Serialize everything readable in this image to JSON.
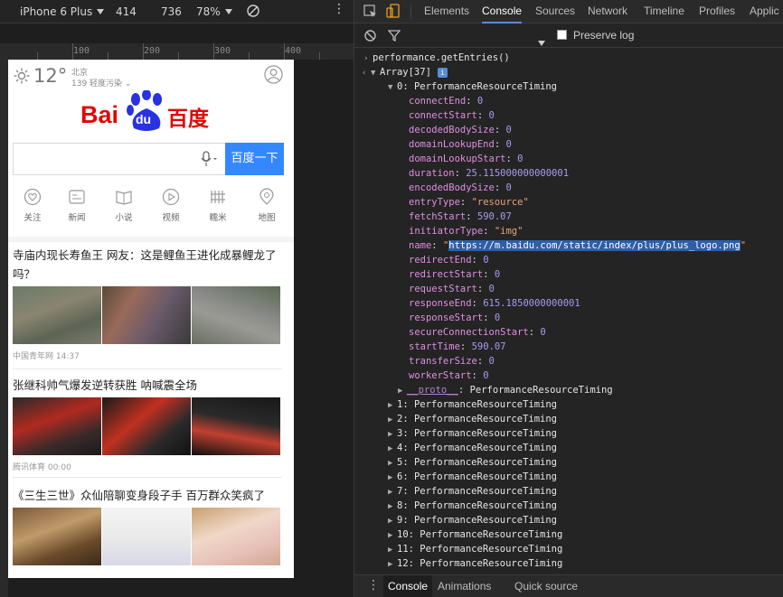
{
  "device_toolbar": {
    "device": "iPhone 6 Plus",
    "width": "414",
    "height": "736",
    "zoom": "78%"
  },
  "ruler": {
    "labels": [
      "100",
      "200",
      "300",
      "400"
    ]
  },
  "phone": {
    "temperature": "12°",
    "city": "北京",
    "air_quality": "139 轻度污染",
    "logo_text_left": "Bai",
    "logo_text_du": "du",
    "logo_text_right": "百度",
    "search_button": "百度一下",
    "nav": [
      "关注",
      "新闻",
      "小说",
      "视频",
      "糯米",
      "地图"
    ],
    "news": [
      {
        "title": "寺庙内现长寿鱼王 网友：这是鲤鱼王进化成暴鲤龙了吗？",
        "source": "中国青年网  14:37"
      },
      {
        "title": "张继科帅气爆发逆转获胜 呐喊震全场",
        "source": "腾讯体育  00:00"
      },
      {
        "title": "《三生三世》众仙陪聊变身段子手 百万群众笑疯了",
        "source": ""
      }
    ]
  },
  "devtools": {
    "tabs": [
      "Elements",
      "Console",
      "Sources",
      "Network",
      "Timeline",
      "Profiles",
      "Applic"
    ],
    "active_tab": "Console",
    "preserve_log": "Preserve log",
    "command": "performance.getEntries()",
    "array_label": "Array[37]",
    "entry0_header": "0: PerformanceResourceTiming",
    "props": [
      {
        "key": "connectEnd",
        "val": "0",
        "type": "n"
      },
      {
        "key": "connectStart",
        "val": "0",
        "type": "n"
      },
      {
        "key": "decodedBodySize",
        "val": "0",
        "type": "n"
      },
      {
        "key": "domainLookupEnd",
        "val": "0",
        "type": "n"
      },
      {
        "key": "domainLookupStart",
        "val": "0",
        "type": "n"
      },
      {
        "key": "duration",
        "val": "25.115000000000001",
        "type": "n"
      },
      {
        "key": "encodedBodySize",
        "val": "0",
        "type": "n"
      },
      {
        "key": "entryType",
        "val": "\"resource\"",
        "type": "s"
      },
      {
        "key": "fetchStart",
        "val": "590.07",
        "type": "n"
      },
      {
        "key": "initiatorType",
        "val": "\"img\"",
        "type": "s"
      },
      {
        "key": "name",
        "val": "https://m.baidu.com/static/index/plus/plus_logo.png",
        "type": "url"
      },
      {
        "key": "redirectEnd",
        "val": "0",
        "type": "n"
      },
      {
        "key": "redirectStart",
        "val": "0",
        "type": "n"
      },
      {
        "key": "requestStart",
        "val": "0",
        "type": "n"
      },
      {
        "key": "responseEnd",
        "val": "615.1850000000001",
        "type": "n"
      },
      {
        "key": "responseStart",
        "val": "0",
        "type": "n"
      },
      {
        "key": "secureConnectionStart",
        "val": "0",
        "type": "n"
      },
      {
        "key": "startTime",
        "val": "590.07",
        "type": "n"
      },
      {
        "key": "transferSize",
        "val": "0",
        "type": "n"
      },
      {
        "key": "workerStart",
        "val": "0",
        "type": "n"
      }
    ],
    "proto_key": "__proto__",
    "proto_val": "PerformanceResourceTiming",
    "entries": [
      "1: PerformanceResourceTiming",
      "2: PerformanceResourceTiming",
      "3: PerformanceResourceTiming",
      "4: PerformanceResourceTiming",
      "5: PerformanceResourceTiming",
      "6: PerformanceResourceTiming",
      "7: PerformanceResourceTiming",
      "8: PerformanceResourceTiming",
      "9: PerformanceResourceTiming",
      "10: PerformanceResourceTiming",
      "11: PerformanceResourceTiming",
      "12: PerformanceResourceTiming"
    ],
    "bottom_tabs": [
      "Console",
      "Animations",
      "Quick source"
    ]
  }
}
